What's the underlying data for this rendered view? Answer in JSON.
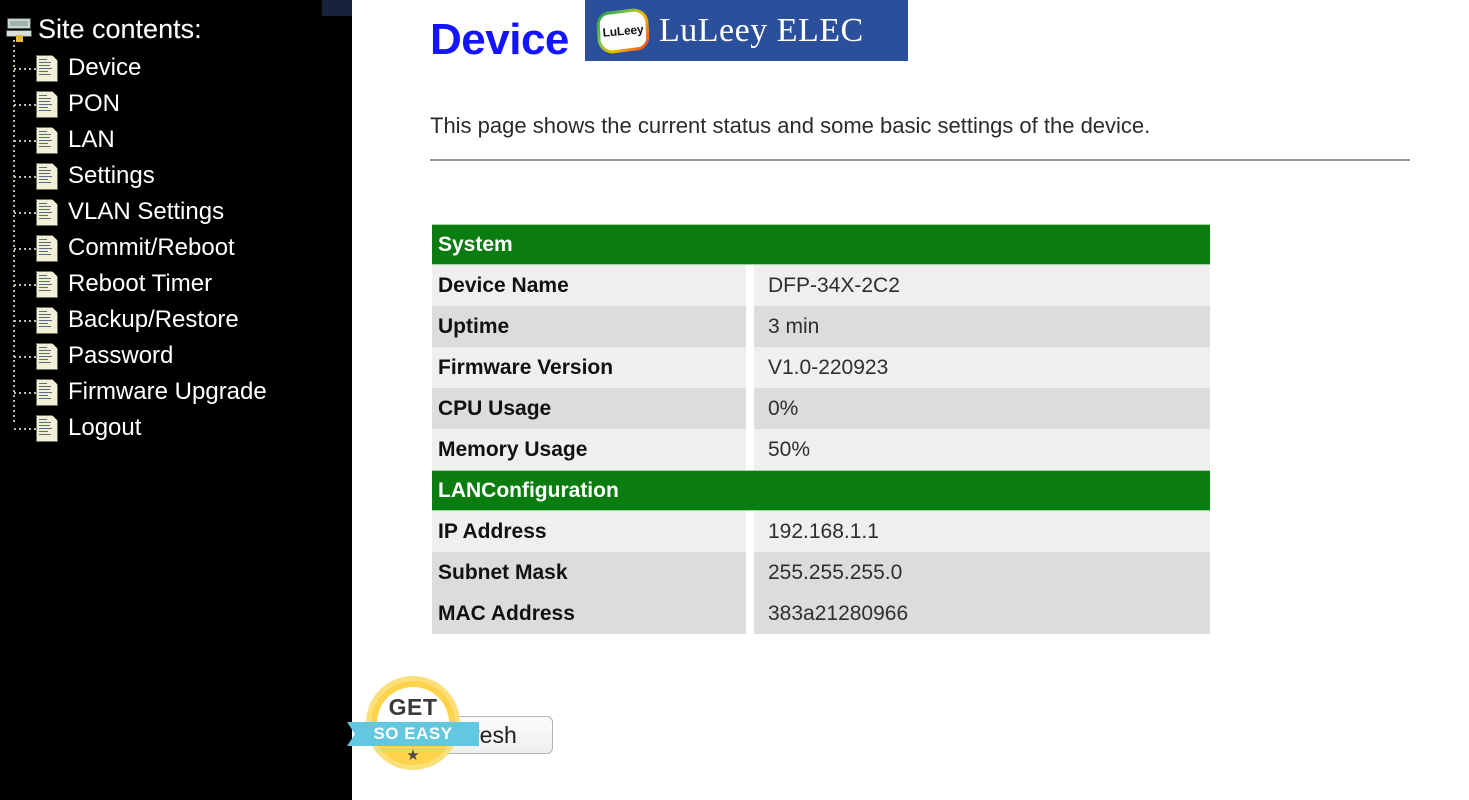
{
  "sidebar": {
    "root_label": "Site contents:",
    "root_icon": "computer-icon",
    "items": [
      {
        "label": "Device",
        "icon": "page-icon"
      },
      {
        "label": "PON",
        "icon": "page-icon"
      },
      {
        "label": "LAN",
        "icon": "page-icon"
      },
      {
        "label": "Settings",
        "icon": "page-icon"
      },
      {
        "label": "VLAN Settings",
        "icon": "page-icon"
      },
      {
        "label": "Commit/Reboot",
        "icon": "page-icon"
      },
      {
        "label": "Reboot Timer",
        "icon": "page-icon"
      },
      {
        "label": "Backup/Restore",
        "icon": "page-icon"
      },
      {
        "label": "Password",
        "icon": "page-icon"
      },
      {
        "label": "Firmware Upgrade",
        "icon": "page-icon"
      },
      {
        "label": "Logout",
        "icon": "page-icon"
      }
    ]
  },
  "main": {
    "title": "Device",
    "description": "This page shows the current status and some basic settings of the device.",
    "refresh_label": "Refresh",
    "sections": [
      {
        "heading": "System",
        "rows": [
          {
            "label": "Device Name",
            "value": "DFP-34X-2C2"
          },
          {
            "label": "Uptime",
            "value": "3 min"
          },
          {
            "label": "Firmware Version",
            "value": "V1.0-220923"
          },
          {
            "label": "CPU Usage",
            "value": "0%"
          },
          {
            "label": "Memory Usage",
            "value": "50%"
          }
        ]
      },
      {
        "heading": "LANConfiguration",
        "rows": [
          {
            "label": "IP Address",
            "value": "192.168.1.1"
          },
          {
            "label": "Subnet Mask",
            "value": "255.255.255.0"
          },
          {
            "label": "MAC Address",
            "value": "383a21280966"
          }
        ]
      }
    ]
  },
  "watermarks": {
    "banner": {
      "brand_text": "LuLeey ELEC",
      "logo_text": "LuLeey",
      "background_color": "#2c4f9c"
    },
    "badge": {
      "top_text": "GET",
      "ribbon_text": "SO EASY",
      "disc_color": "#fcd34a",
      "ribbon_color": "#62c8e0"
    }
  },
  "colors": {
    "section_header_green": "#0b7d10",
    "title_blue": "#1414ff",
    "row_light": "#efefef",
    "row_dark": "#dcdcdc",
    "sidebar_background": "#000000"
  }
}
